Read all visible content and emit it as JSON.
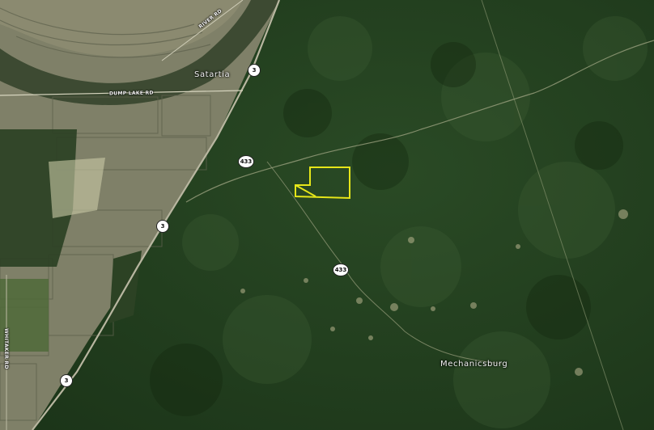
{
  "places": {
    "satartia": "Satartia",
    "mechanicsburg": "Mechanicsburg"
  },
  "roads": {
    "dump_lake_rd": "DUMP LAKE RD",
    "river_rd": "RIVER RD",
    "whitaker_rd": "WHITAKER RD"
  },
  "shields": {
    "hwy3_north": "3",
    "hwy3_mid": "3",
    "hwy3_south": "3",
    "hwy433_west": "433",
    "hwy433_south": "433"
  },
  "colors": {
    "forest": "#22401f",
    "farmland": "#8a8a72",
    "parcel_outline": "#e6e619"
  }
}
